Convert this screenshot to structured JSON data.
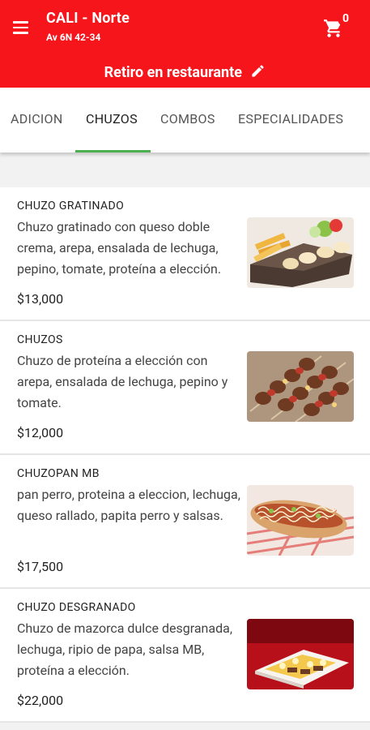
{
  "header": {
    "title": "CALI - Norte",
    "address": "Av 6N 42-34",
    "cart_count": "0",
    "pickup_label": "Retiro en restaurante",
    "menu_icon": "hamburger-menu-icon",
    "cart_icon": "shopping-cart-icon",
    "edit_icon": "pencil-icon",
    "bg_color": "#f5151b"
  },
  "tabs": [
    {
      "label": "ADICION",
      "active": false
    },
    {
      "label": "CHUZOS",
      "active": true
    },
    {
      "label": "COMBOS",
      "active": false
    },
    {
      "label": "ESPECIALIDADES",
      "active": false
    }
  ],
  "accent_color": "#4caf50",
  "items": [
    {
      "name": "CHUZO GRATINADO",
      "description": "Chuzo gratinado con queso doble crema, arepa, ensalada de lechuga, pepino, tomate, proteína a elección.",
      "price": "$13,000"
    },
    {
      "name": "CHUZOS",
      "description": "Chuzo de proteína a elección con arepa, ensalada de lechuga, pepino y tomate.",
      "price": "$12,000"
    },
    {
      "name": "CHUZOPAN MB",
      "description": "pan perro, proteina a eleccion, lechuga, queso rallado, papita perro y salsas.",
      "price": "$17,500"
    },
    {
      "name": "CHUZO DESGRANADO",
      "description": "Chuzo de mazorca dulce desgranada, lechuga, ripio de papa, salsa MB, proteína a elección.",
      "price": "$22,000"
    }
  ]
}
